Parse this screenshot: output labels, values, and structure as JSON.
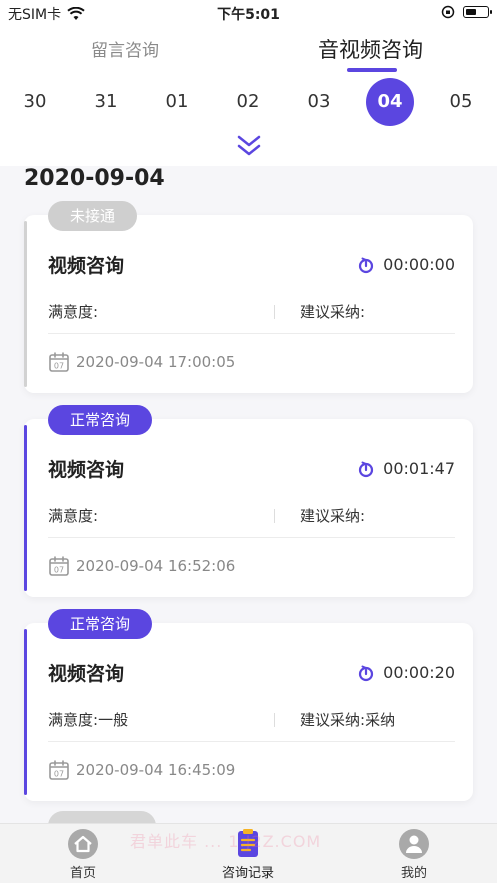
{
  "status_bar": {
    "carrier": "无SIM卡",
    "time": "下午5:01"
  },
  "tabs": [
    {
      "label": "留言咨询",
      "active": false
    },
    {
      "label": "音视频咨询",
      "active": true
    }
  ],
  "dates": [
    "30",
    "31",
    "01",
    "02",
    "03",
    "04",
    "05"
  ],
  "selected_date": "04",
  "date_heading": "2020-09-04",
  "records": [
    {
      "status": "未接通",
      "title": "视频咨询",
      "duration": "00:00:00",
      "satisfaction_label": "满意度:",
      "satisfaction_value": "",
      "adopt_label": "建议采纳:",
      "adopt_value": "",
      "datetime": "2020-09-04 17:00:05",
      "calendar_day": "07"
    },
    {
      "status": "正常咨询",
      "title": "视频咨询",
      "duration": "00:01:47",
      "satisfaction_label": "满意度:",
      "satisfaction_value": "",
      "adopt_label": "建议采纳:",
      "adopt_value": "",
      "datetime": "2020-09-04 16:52:06",
      "calendar_day": "07"
    },
    {
      "status": "正常咨询",
      "title": "视频咨询",
      "duration": "00:00:20",
      "satisfaction_label": "满意度:",
      "satisfaction_value": "一般",
      "adopt_label": "建议采纳:",
      "adopt_value": "采纳",
      "datetime": "2020-09-04 16:45:09",
      "calendar_day": "07"
    }
  ],
  "tabbar": [
    {
      "label": "首页",
      "icon": "home-icon"
    },
    {
      "label": "咨询记录",
      "icon": "record-icon"
    },
    {
      "label": "我的",
      "icon": "profile-icon"
    }
  ],
  "watermark": "君单此车 ... 1.J2Z.COM",
  "colors": {
    "accent": "#5b46e0",
    "inactive_badge": "#cfcfcf"
  }
}
